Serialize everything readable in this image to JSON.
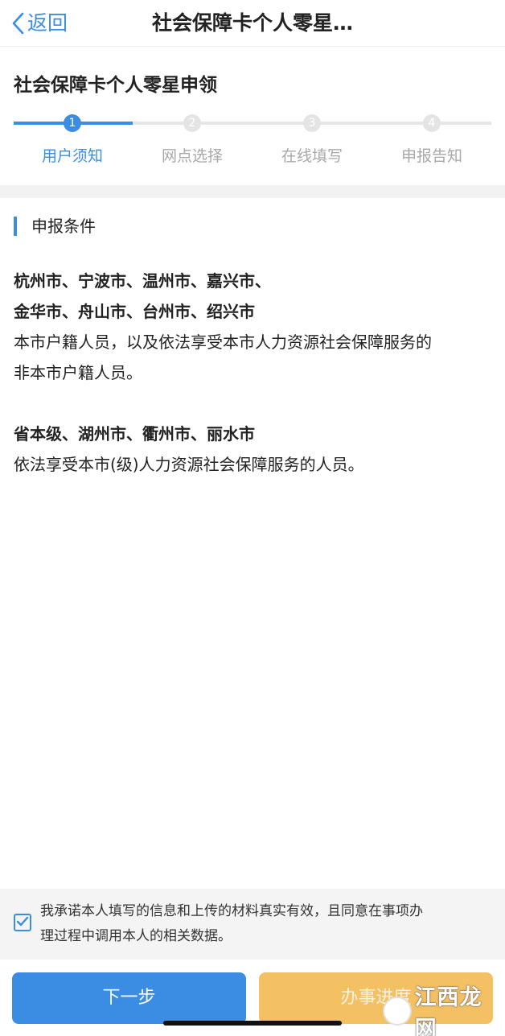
{
  "navbar": {
    "back_label": "返回",
    "title": "社会保障卡个人零星…"
  },
  "page": {
    "title": "社会保障卡个人零星申领"
  },
  "steps": [
    {
      "number": "1",
      "label": "用户须知",
      "active": true
    },
    {
      "number": "2",
      "label": "网点选择",
      "active": false
    },
    {
      "number": "3",
      "label": "在线填写",
      "active": false
    },
    {
      "number": "4",
      "label": "申报告知",
      "active": false
    }
  ],
  "section": {
    "title": "申报条件",
    "lines": [
      {
        "text": "杭州市、宁波市、温州市、嘉兴市、",
        "bold": true
      },
      {
        "text": "金华市、舟山市、台州市、绍兴市",
        "bold": true
      },
      {
        "text": "本市户籍人员，以及依法享受本市人力资源社会保障服务的",
        "bold": false
      },
      {
        "text": "非本市户籍人员。",
        "bold": false
      },
      {
        "text": "省本级、湖州市、衢州市、丽水市",
        "bold": true
      },
      {
        "text": "依法享受本市(级)人力资源社会保障服务的人员。",
        "bold": false
      }
    ]
  },
  "agreement": {
    "checked": true,
    "text_line1": "我承诺本人填写的信息和上传的材料真实有效，且同意在事项办",
    "text_line2": "理过程中调用本人的相关数据。"
  },
  "footer": {
    "next_label": "下一步",
    "progress_label": "办事进度"
  },
  "watermark": {
    "text": "江西龙网"
  },
  "colors": {
    "primary": "#3b8de3",
    "secondary_button": "#f4c064",
    "inactive_step": "#e4e4e4"
  },
  "icons": {
    "back": "chevron-left-icon",
    "checkbox": "checkmark-icon"
  }
}
